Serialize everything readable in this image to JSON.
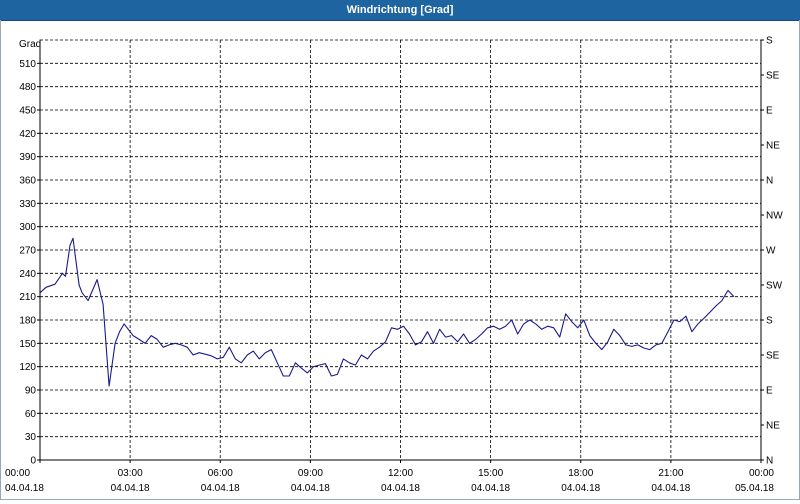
{
  "window": {
    "title": "Windrichtung [Grad]"
  },
  "colors": {
    "titlebar": "#1e64a0",
    "line": "#1a1a8c",
    "grid": "#000000"
  },
  "chart_data": {
    "type": "line",
    "title": "Windrichtung [Grad]",
    "ylabel": "Grad",
    "ylim": [
      0,
      540
    ],
    "xlim_hours": [
      0,
      24
    ],
    "grid": "dashed",
    "y_ticks": [
      0,
      30,
      60,
      90,
      120,
      150,
      180,
      210,
      240,
      270,
      300,
      330,
      360,
      390,
      420,
      450,
      480,
      510
    ],
    "right_axis_labels": [
      {
        "value": 0,
        "label": "N"
      },
      {
        "value": 45,
        "label": "NE"
      },
      {
        "value": 90,
        "label": "E"
      },
      {
        "value": 135,
        "label": "SE"
      },
      {
        "value": 180,
        "label": "S"
      },
      {
        "value": 225,
        "label": "SW"
      },
      {
        "value": 270,
        "label": "W"
      },
      {
        "value": 315,
        "label": "NW"
      },
      {
        "value": 360,
        "label": "N"
      },
      {
        "value": 405,
        "label": "NE"
      },
      {
        "value": 450,
        "label": "E"
      },
      {
        "value": 495,
        "label": "SE"
      },
      {
        "value": 540,
        "label": "S"
      }
    ],
    "x_ticks": [
      {
        "hour": 0,
        "time": "00:00",
        "date": "04.04.18"
      },
      {
        "hour": 3,
        "time": "03:00",
        "date": "04.04.18"
      },
      {
        "hour": 6,
        "time": "06:00",
        "date": "04.04.18"
      },
      {
        "hour": 9,
        "time": "09:00",
        "date": "04.04.18"
      },
      {
        "hour": 12,
        "time": "12:00",
        "date": "04.04.18"
      },
      {
        "hour": 15,
        "time": "15:00",
        "date": "04.04.18"
      },
      {
        "hour": 18,
        "time": "18:00",
        "date": "04.04.18"
      },
      {
        "hour": 21,
        "time": "21:00",
        "date": "04.04.18"
      },
      {
        "hour": 24,
        "time": "00:00",
        "date": "05.04.18"
      }
    ],
    "series": [
      {
        "hours": [
          0,
          0.2,
          0.5,
          0.75,
          0.85,
          1.0,
          1.1,
          1.3,
          1.4,
          1.6,
          1.9,
          2.1,
          2.3,
          2.5,
          2.65,
          2.8,
          3.0,
          3.1,
          3.3,
          3.5,
          3.7,
          3.9,
          4.1,
          4.3,
          4.5,
          4.7,
          4.9,
          5.1,
          5.3,
          5.5,
          5.7,
          5.9,
          6.1,
          6.3,
          6.5,
          6.7,
          6.9,
          7.1,
          7.3,
          7.5,
          7.7,
          7.9,
          8.1,
          8.3,
          8.5,
          8.7,
          8.9,
          9.1,
          9.3,
          9.5,
          9.7,
          9.9,
          10.1,
          10.3,
          10.5,
          10.7,
          10.9,
          11.1,
          11.3,
          11.5,
          11.7,
          11.9,
          12.1,
          12.3,
          12.5,
          12.7,
          12.9,
          13.1,
          13.3,
          13.5,
          13.7,
          13.9,
          14.1,
          14.3,
          14.5,
          14.7,
          14.9,
          15.1,
          15.3,
          15.5,
          15.7,
          15.9,
          16.1,
          16.3,
          16.5,
          16.7,
          16.9,
          17.1,
          17.3,
          17.5,
          17.7,
          17.9,
          18.1,
          18.3,
          18.5,
          18.7,
          18.9,
          19.1,
          19.3,
          19.5,
          19.7,
          19.9,
          20.1,
          20.3,
          20.5,
          20.7,
          20.9,
          21.1,
          21.3,
          21.5,
          21.7,
          21.9,
          22.1,
          22.3,
          22.5,
          22.7,
          22.9,
          23.1,
          23.3,
          23.5,
          23.7,
          23.9
        ],
        "values": [
          215,
          222,
          226,
          240,
          236,
          276,
          285,
          225,
          215,
          205,
          232,
          200,
          95,
          150,
          165,
          175,
          165,
          160,
          155,
          150,
          160,
          155,
          145,
          148,
          150,
          148,
          145,
          135,
          138,
          136,
          134,
          130,
          132,
          145,
          130,
          125,
          135,
          140,
          130,
          138,
          142,
          125,
          108,
          108,
          125,
          118,
          112,
          120,
          122,
          124,
          108,
          110,
          130,
          125,
          122,
          135,
          130,
          140,
          145,
          152,
          170,
          168,
          172,
          162,
          148,
          152,
          165,
          150,
          168,
          158,
          160,
          152,
          162,
          150,
          155,
          162,
          170,
          172,
          168,
          172,
          180,
          162,
          175,
          180,
          175,
          168,
          172,
          170,
          158,
          188,
          178,
          170,
          180,
          160,
          150,
          142,
          152,
          168,
          160,
          148,
          146,
          148,
          144,
          142,
          148,
          150,
          165,
          180,
          178,
          185,
          165,
          175,
          182,
          190,
          198,
          205,
          218,
          210
        ]
      }
    ]
  }
}
